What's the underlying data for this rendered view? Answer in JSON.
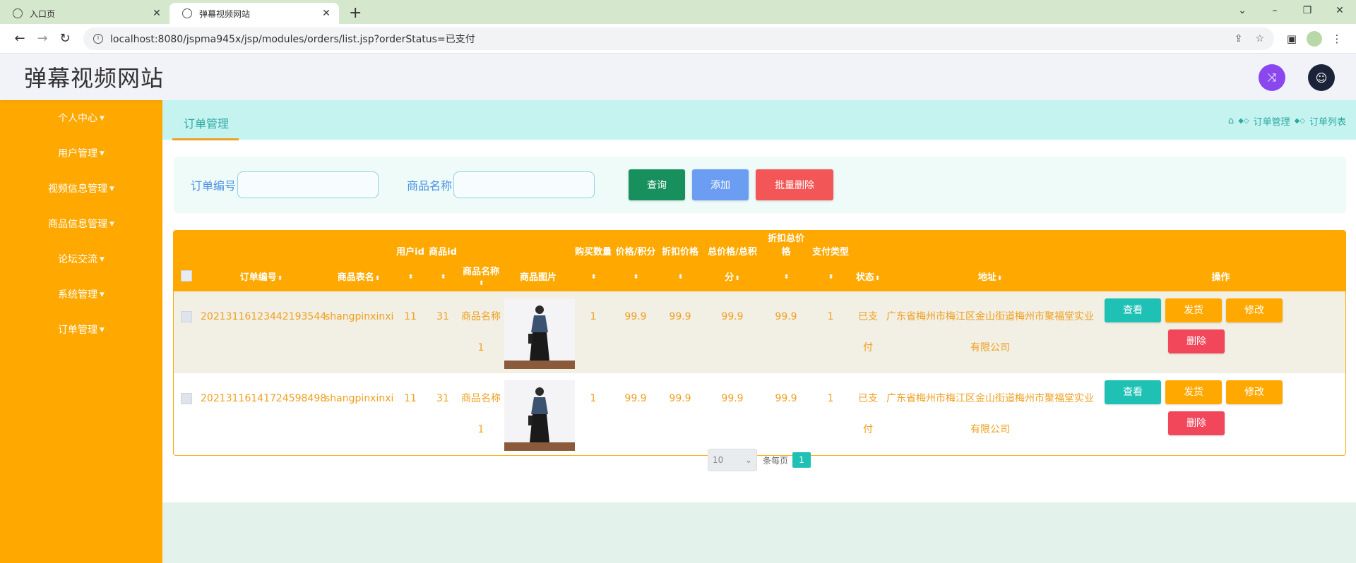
{
  "browser": {
    "tabs": [
      {
        "title": "入口页"
      },
      {
        "title": "弹幕视频网站"
      }
    ],
    "url": "localhost:8080/jspma945x/jsp/modules/orders/list.jsp?orderStatus=已支付"
  },
  "header": {
    "site_title": "弹幕视频网站"
  },
  "sidebar": {
    "items": [
      {
        "label": "个人中心"
      },
      {
        "label": "用户管理"
      },
      {
        "label": "视频信息管理"
      },
      {
        "label": "商品信息管理"
      },
      {
        "label": "论坛交流"
      },
      {
        "label": "系统管理"
      },
      {
        "label": "订单管理"
      }
    ]
  },
  "page": {
    "title": "订单管理",
    "breadcrumb": [
      "订单管理",
      "订单列表"
    ]
  },
  "search": {
    "order_no_label": "订单编号",
    "order_no_value": "",
    "goods_name_label": "商品名称",
    "goods_name_value": "",
    "query_label": "查询",
    "add_label": "添加",
    "batch_delete_label": "批量删除"
  },
  "table": {
    "top_headers": {
      "userid": "用户id",
      "goodid": "商品id",
      "buynumber": "购买数量",
      "price": "价格/积分",
      "discountprice": "折扣价格",
      "total_top": "总价格/总积",
      "total_bottom": "分",
      "discounttotal": "折扣总价格",
      "type": "支付类型"
    },
    "headers": {
      "orderid": "订单编号",
      "tablename": "商品表名",
      "goodname": "商品名称",
      "picture": "商品图片",
      "status": "状态",
      "address": "地址",
      "ops": "操作"
    },
    "rows": [
      {
        "orderid": "20213116123442193544",
        "tablename": "shangpinxinxi",
        "userid": "11",
        "goodid": "31",
        "goodname_1": "商品名称",
        "goodname_2": "1",
        "buynumber": "1",
        "price": "99.9",
        "discountprice": "99.9",
        "total": "99.9",
        "discounttotal": "99.9",
        "type": "1",
        "status_1": "已支",
        "status_2": "付",
        "address_1": "广东省梅州市梅江区金山街道梅州市聚福堂实业",
        "address_2": "有限公司"
      },
      {
        "orderid": "20213116141724598498",
        "tablename": "shangpinxinxi",
        "userid": "11",
        "goodid": "31",
        "goodname_1": "商品名称",
        "goodname_2": "1",
        "buynumber": "1",
        "price": "99.9",
        "discountprice": "99.9",
        "total": "99.9",
        "discounttotal": "99.9",
        "type": "1",
        "status_1": "已支",
        "status_2": "付",
        "address_1": "广东省梅州市梅江区金山街道梅州市聚福堂实业",
        "address_2": "有限公司"
      }
    ],
    "actions": {
      "view": "查看",
      "ship": "发货",
      "edit": "修改",
      "delete": "删除"
    }
  },
  "pager": {
    "page_size": "10",
    "per_page_label": "条每页",
    "current_page": "1"
  },
  "colors": {
    "sidebar": "#ffa800",
    "accent_teal": "#1fc1b4",
    "danger": "#f2465a",
    "query": "#17905e",
    "add": "#6b9ef2"
  }
}
